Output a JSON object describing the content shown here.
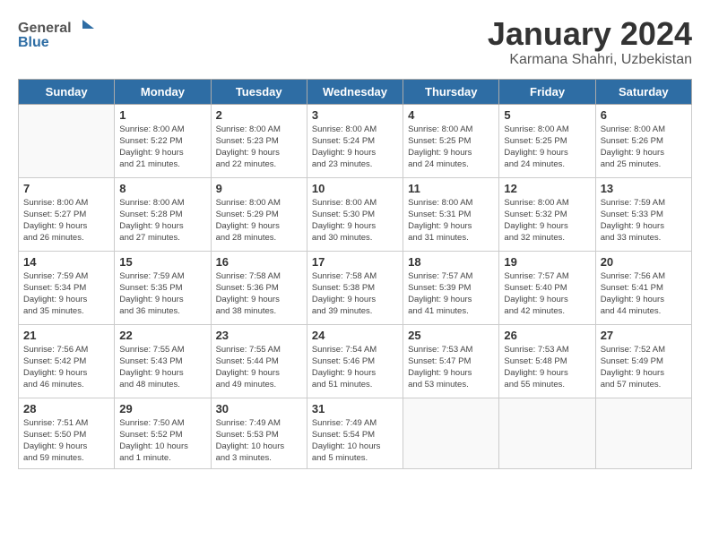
{
  "header": {
    "logo_general": "General",
    "logo_blue": "Blue",
    "title": "January 2024",
    "subtitle": "Karmana Shahri, Uzbekistan"
  },
  "days_of_week": [
    "Sunday",
    "Monday",
    "Tuesday",
    "Wednesday",
    "Thursday",
    "Friday",
    "Saturday"
  ],
  "weeks": [
    [
      {
        "day": "",
        "info": ""
      },
      {
        "day": "1",
        "info": "Sunrise: 8:00 AM\nSunset: 5:22 PM\nDaylight: 9 hours\nand 21 minutes."
      },
      {
        "day": "2",
        "info": "Sunrise: 8:00 AM\nSunset: 5:23 PM\nDaylight: 9 hours\nand 22 minutes."
      },
      {
        "day": "3",
        "info": "Sunrise: 8:00 AM\nSunset: 5:24 PM\nDaylight: 9 hours\nand 23 minutes."
      },
      {
        "day": "4",
        "info": "Sunrise: 8:00 AM\nSunset: 5:25 PM\nDaylight: 9 hours\nand 24 minutes."
      },
      {
        "day": "5",
        "info": "Sunrise: 8:00 AM\nSunset: 5:25 PM\nDaylight: 9 hours\nand 24 minutes."
      },
      {
        "day": "6",
        "info": "Sunrise: 8:00 AM\nSunset: 5:26 PM\nDaylight: 9 hours\nand 25 minutes."
      }
    ],
    [
      {
        "day": "7",
        "info": "Sunrise: 8:00 AM\nSunset: 5:27 PM\nDaylight: 9 hours\nand 26 minutes."
      },
      {
        "day": "8",
        "info": "Sunrise: 8:00 AM\nSunset: 5:28 PM\nDaylight: 9 hours\nand 27 minutes."
      },
      {
        "day": "9",
        "info": "Sunrise: 8:00 AM\nSunset: 5:29 PM\nDaylight: 9 hours\nand 28 minutes."
      },
      {
        "day": "10",
        "info": "Sunrise: 8:00 AM\nSunset: 5:30 PM\nDaylight: 9 hours\nand 30 minutes."
      },
      {
        "day": "11",
        "info": "Sunrise: 8:00 AM\nSunset: 5:31 PM\nDaylight: 9 hours\nand 31 minutes."
      },
      {
        "day": "12",
        "info": "Sunrise: 8:00 AM\nSunset: 5:32 PM\nDaylight: 9 hours\nand 32 minutes."
      },
      {
        "day": "13",
        "info": "Sunrise: 7:59 AM\nSunset: 5:33 PM\nDaylight: 9 hours\nand 33 minutes."
      }
    ],
    [
      {
        "day": "14",
        "info": "Sunrise: 7:59 AM\nSunset: 5:34 PM\nDaylight: 9 hours\nand 35 minutes."
      },
      {
        "day": "15",
        "info": "Sunrise: 7:59 AM\nSunset: 5:35 PM\nDaylight: 9 hours\nand 36 minutes."
      },
      {
        "day": "16",
        "info": "Sunrise: 7:58 AM\nSunset: 5:36 PM\nDaylight: 9 hours\nand 38 minutes."
      },
      {
        "day": "17",
        "info": "Sunrise: 7:58 AM\nSunset: 5:38 PM\nDaylight: 9 hours\nand 39 minutes."
      },
      {
        "day": "18",
        "info": "Sunrise: 7:57 AM\nSunset: 5:39 PM\nDaylight: 9 hours\nand 41 minutes."
      },
      {
        "day": "19",
        "info": "Sunrise: 7:57 AM\nSunset: 5:40 PM\nDaylight: 9 hours\nand 42 minutes."
      },
      {
        "day": "20",
        "info": "Sunrise: 7:56 AM\nSunset: 5:41 PM\nDaylight: 9 hours\nand 44 minutes."
      }
    ],
    [
      {
        "day": "21",
        "info": "Sunrise: 7:56 AM\nSunset: 5:42 PM\nDaylight: 9 hours\nand 46 minutes."
      },
      {
        "day": "22",
        "info": "Sunrise: 7:55 AM\nSunset: 5:43 PM\nDaylight: 9 hours\nand 48 minutes."
      },
      {
        "day": "23",
        "info": "Sunrise: 7:55 AM\nSunset: 5:44 PM\nDaylight: 9 hours\nand 49 minutes."
      },
      {
        "day": "24",
        "info": "Sunrise: 7:54 AM\nSunset: 5:46 PM\nDaylight: 9 hours\nand 51 minutes."
      },
      {
        "day": "25",
        "info": "Sunrise: 7:53 AM\nSunset: 5:47 PM\nDaylight: 9 hours\nand 53 minutes."
      },
      {
        "day": "26",
        "info": "Sunrise: 7:53 AM\nSunset: 5:48 PM\nDaylight: 9 hours\nand 55 minutes."
      },
      {
        "day": "27",
        "info": "Sunrise: 7:52 AM\nSunset: 5:49 PM\nDaylight: 9 hours\nand 57 minutes."
      }
    ],
    [
      {
        "day": "28",
        "info": "Sunrise: 7:51 AM\nSunset: 5:50 PM\nDaylight: 9 hours\nand 59 minutes."
      },
      {
        "day": "29",
        "info": "Sunrise: 7:50 AM\nSunset: 5:52 PM\nDaylight: 10 hours\nand 1 minute."
      },
      {
        "day": "30",
        "info": "Sunrise: 7:49 AM\nSunset: 5:53 PM\nDaylight: 10 hours\nand 3 minutes."
      },
      {
        "day": "31",
        "info": "Sunrise: 7:49 AM\nSunset: 5:54 PM\nDaylight: 10 hours\nand 5 minutes."
      },
      {
        "day": "",
        "info": ""
      },
      {
        "day": "",
        "info": ""
      },
      {
        "day": "",
        "info": ""
      }
    ]
  ]
}
